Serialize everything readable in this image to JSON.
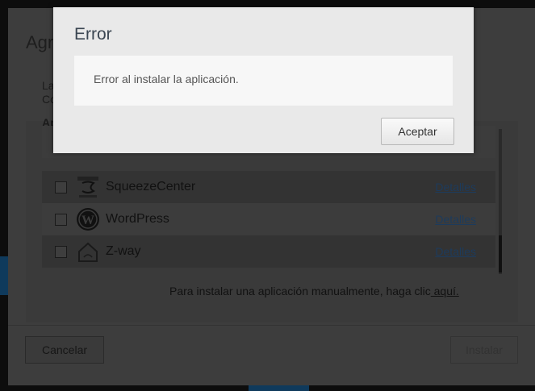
{
  "dialog": {
    "title": "Agr",
    "intro_lines": [
      "La",
      "Co"
    ],
    "section_heading": "Ap",
    "apps": [
      {
        "name": "",
        "details": "",
        "icon": "partially-hidden-app-icon"
      },
      {
        "name": "SqueezeCenter",
        "details": "Detalles",
        "icon": "squeezecenter-icon"
      },
      {
        "name": "WordPress",
        "details": "Detalles",
        "icon": "wordpress-icon"
      },
      {
        "name": "Z-way",
        "details": "Detalles",
        "icon": "zway-house-icon"
      }
    ],
    "manual_text": "Para instalar una aplicación manualmente, haga clic",
    "manual_link": " aquí.",
    "cancel_label": "Cancelar",
    "install_label": "Instalar"
  },
  "error_modal": {
    "title": "Error",
    "message": "Error al instalar la aplicación.",
    "ok_label": "Aceptar"
  },
  "colors": {
    "overlay": "#0d0d0d",
    "modal_bg": "#e9e9e9",
    "link": "#1d3b5c"
  }
}
